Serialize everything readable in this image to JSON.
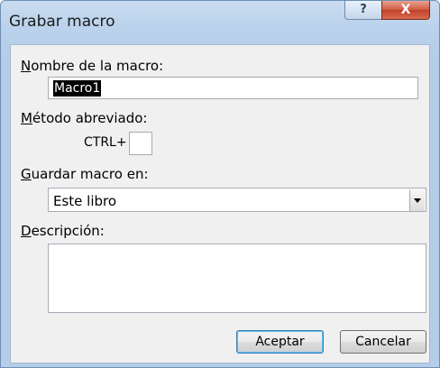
{
  "window": {
    "title": "Grabar macro",
    "help_glyph": "?",
    "close_glyph": "X"
  },
  "macro_name": {
    "label_accel": "N",
    "label_rest": "ombre de la macro:",
    "value": "Macro1"
  },
  "shortcut": {
    "label_accel": "M",
    "label_rest": "étodo abreviado:",
    "ctrl_text": "CTRL+",
    "key_value": ""
  },
  "store_in": {
    "label_accel": "G",
    "label_rest": "uardar macro en:",
    "selected": "Este libro"
  },
  "description": {
    "label_accel": "D",
    "label_rest": "escripción:",
    "value": ""
  },
  "buttons": {
    "ok": "Aceptar",
    "cancel": "Cancelar"
  }
}
